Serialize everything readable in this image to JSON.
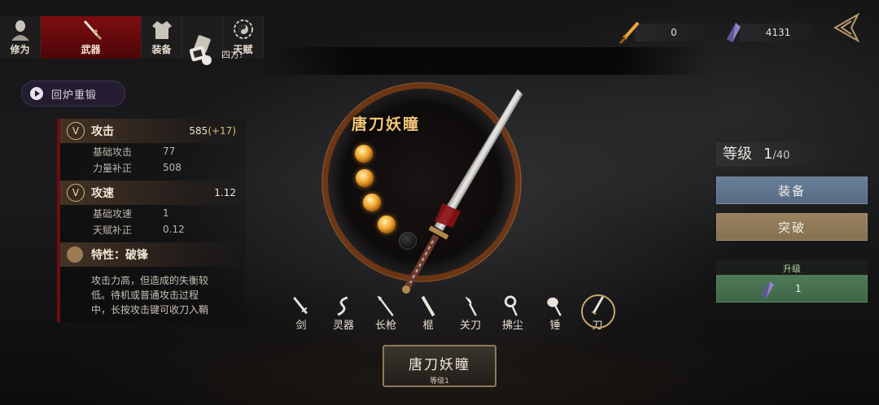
{
  "tabs": [
    {
      "label": "修为",
      "icon": "cultivator-portrait-icon",
      "active": false
    },
    {
      "label": "武器",
      "icon": "sword-icon",
      "active": true
    },
    {
      "label": "装备",
      "icon": "robe-icon",
      "active": false
    },
    {
      "label": "",
      "icon": "scroll-icon",
      "active": false
    },
    {
      "label": "天赋",
      "icon": "bagua-icon",
      "active": false
    }
  ],
  "toast": {
    "text": "四方!"
  },
  "currency": {
    "spirit_blade": {
      "value": "0",
      "icon": "orange-blade-icon"
    },
    "crystal": {
      "value": "4131",
      "icon": "purple-crystal-icon"
    }
  },
  "reforge": {
    "label": "回炉重锻"
  },
  "stats": {
    "attack": {
      "badge": "V",
      "name": "攻击",
      "value": "585",
      "bonus": "(+17)",
      "rows": [
        {
          "k": "基础攻击",
          "v": "77"
        },
        {
          "k": "力量补正",
          "v": "508"
        }
      ]
    },
    "speed": {
      "badge": "V",
      "name": "攻速",
      "value": "1.12",
      "rows": [
        {
          "k": "基础攻速",
          "v": "1"
        },
        {
          "k": "天赋补正",
          "v": "0.12"
        }
      ]
    },
    "trait": {
      "name": "特性：破锋",
      "desc": "攻击力高，但造成的失衡较低。待机或普通攻击过程中，长按攻击键可收刀入鞘"
    }
  },
  "weapon": {
    "name": "唐刀妖瞳",
    "orbs_filled": 4,
    "orbs_total": 5
  },
  "weapon_types": [
    {
      "label": "剑",
      "icon": "jian-sword-icon"
    },
    {
      "label": "灵器",
      "icon": "spirit-artifact-icon"
    },
    {
      "label": "长枪",
      "icon": "spear-icon"
    },
    {
      "label": "棍",
      "icon": "staff-icon"
    },
    {
      "label": "关刀",
      "icon": "guandao-icon"
    },
    {
      "label": "拂尘",
      "icon": "whisk-icon"
    },
    {
      "label": "锤",
      "icon": "hammer-icon"
    },
    {
      "label": "刀",
      "icon": "dao-blade-icon",
      "active": true
    }
  ],
  "plate": {
    "name": "唐刀妖瞳",
    "level": "等级1"
  },
  "right": {
    "level_label": "等级",
    "level_current": "1",
    "level_max": "/40",
    "equip": "装备",
    "breakthrough": "突破",
    "upgrade_title": "升级",
    "upgrade_cost": "1"
  },
  "colors": {
    "accent_red": "#7d0d10",
    "gold": "#f4c879",
    "equip_blue": "#6a7f98",
    "break_tan": "#9a8260",
    "upgrade_green": "#4e7a58"
  }
}
